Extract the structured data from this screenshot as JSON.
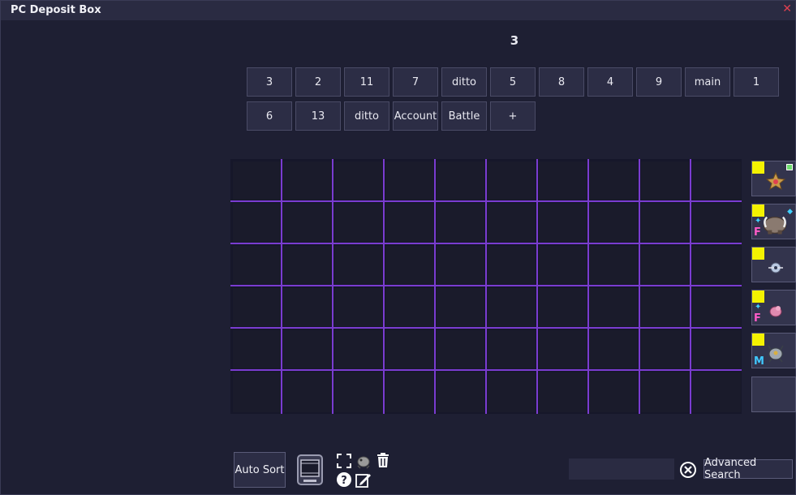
{
  "window": {
    "title": "PC Deposit Box",
    "close_glyph": "✕"
  },
  "box": {
    "current_name": "3"
  },
  "tabs_row1": [
    "3",
    "2",
    "11",
    "7",
    "ditto",
    "5",
    "8",
    "4",
    "9",
    "main",
    "1"
  ],
  "tabs_row2": [
    "6",
    "13",
    "ditto",
    "Account",
    "Battle",
    "+"
  ],
  "grid": {
    "columns": 10,
    "rows": 6,
    "line_color": "#7a3cd0"
  },
  "party": [
    {
      "marker": true,
      "sprite": "starmie-sprite-icon",
      "gender": "",
      "shiny": false,
      "held_item": "held-item-icon"
    },
    {
      "marker": true,
      "sprite": "mamoswine-sprite-icon",
      "gender": "F",
      "shiny": true,
      "held_item": "gem-icon"
    },
    {
      "marker": true,
      "sprite": "pokemon-sprite-icon",
      "gender": "",
      "shiny": false,
      "held_item": ""
    },
    {
      "marker": true,
      "sprite": "pokemon-sprite-icon",
      "gender": "F",
      "shiny": true,
      "held_item": ""
    },
    {
      "marker": true,
      "sprite": "pokemon-sprite-icon",
      "gender": "M",
      "shiny": false,
      "held_item": ""
    },
    {
      "marker": false,
      "sprite": "",
      "gender": "",
      "shiny": false,
      "held_item": ""
    }
  ],
  "colors": {
    "marker": "#f4f200",
    "female": "#ff5cc8",
    "male": "#40c8ff",
    "close": "#e04050"
  },
  "toolbar": {
    "auto_sort_label": "Auto Sort",
    "icons": [
      "fullscreen-icon",
      "pokemon-icon",
      "trash-icon",
      "help-icon",
      "edit-icon"
    ]
  },
  "search": {
    "value": "",
    "placeholder": "",
    "advanced_label": "Advanced Search"
  }
}
